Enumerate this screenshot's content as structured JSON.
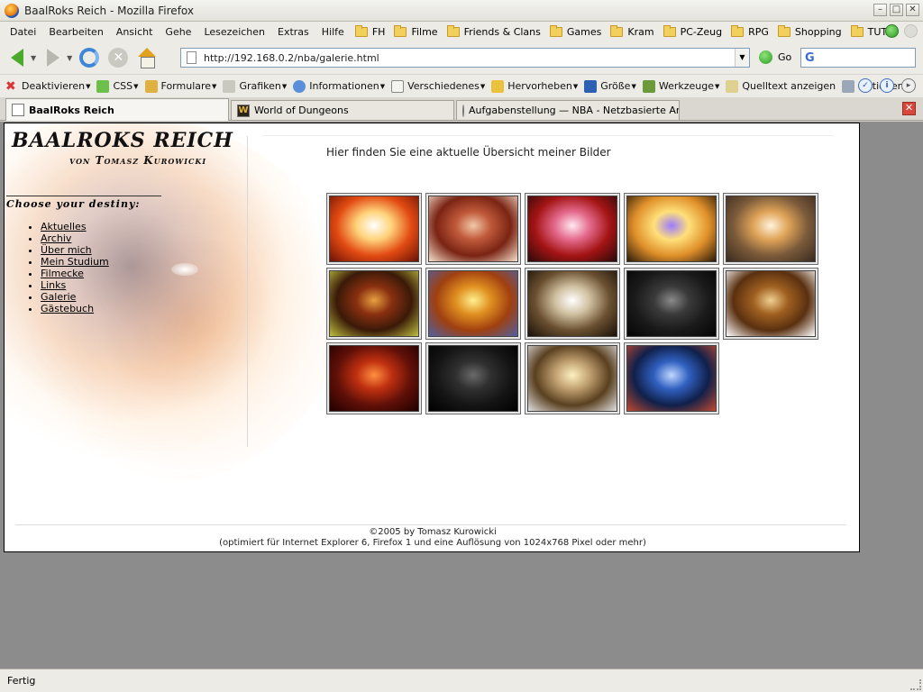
{
  "window": {
    "title": "BaalRoks Reich - Mozilla Firefox"
  },
  "menubar": {
    "items": [
      "Datei",
      "Bearbeiten",
      "Ansicht",
      "Gehe",
      "Lesezeichen",
      "Extras",
      "Hilfe"
    ],
    "bookmarks": [
      "FH",
      "Filme",
      "Friends & Clans",
      "Games",
      "Kram",
      "PC-Zeug",
      "RPG",
      "Shopping",
      "TUTs"
    ]
  },
  "navbar": {
    "url": "http://192.168.0.2/nba/galerie.html",
    "go_label": "Go",
    "search_value": ""
  },
  "devbar": {
    "items": [
      "Deaktivieren",
      "CSS",
      "Formulare",
      "Grafiken",
      "Informationen",
      "Verschiedenes",
      "Hervorheben",
      "Größe",
      "Werkzeuge",
      "Quelltext anzeigen",
      "Optionen"
    ]
  },
  "tabs": [
    {
      "label": "BaalRoks Reich",
      "active": true
    },
    {
      "label": "World of Dungeons",
      "active": false
    },
    {
      "label": "Aufgabenstellung — NBA - Netzbasierte An...",
      "active": false
    }
  ],
  "page": {
    "logo_title": "BaalRoks Reich",
    "logo_sub": "von Tomasz Kurowicki",
    "nav_heading": "Choose your destiny:",
    "nav": [
      "Aktuelles",
      "Archiv",
      "Über mich",
      "Mein Studium",
      "Filmecke",
      "Links",
      "Galerie",
      "Gästebuch"
    ],
    "intro": "Hier finden Sie eine aktuelle Übersicht meiner Bilder",
    "gallery_colors": [
      [
        "#ffffff",
        "#ffd37a",
        "#e24a12",
        "#6a1305"
      ],
      [
        "#f0c9a8",
        "#c0593a",
        "#7a2414",
        "#f6e0cc"
      ],
      [
        "#ffe9f2",
        "#e46a8c",
        "#a41414",
        "#2a0a0a"
      ],
      [
        "#9a7cff",
        "#ffe07a",
        "#e0902a",
        "#2a1a0a"
      ],
      [
        "#fff3dc",
        "#e0a458",
        "#7a5a3a",
        "#3a2a20"
      ],
      [
        "#e8a040",
        "#8a3010",
        "#3a1a08",
        "#c0c040"
      ],
      [
        "#fff090",
        "#e09020",
        "#a04010",
        "#5060a0"
      ],
      [
        "#ffffff",
        "#d0c0a0",
        "#6a5030",
        "#1a1008"
      ],
      [
        "#8a8a8a",
        "#3a3a3a",
        "#1a1a1a",
        "#050505"
      ],
      [
        "#f0d090",
        "#a06020",
        "#5a3010",
        "#ffffff"
      ],
      [
        "#ff9040",
        "#c03010",
        "#601008",
        "#200000"
      ],
      [
        "#6a6a6a",
        "#303030",
        "#151515",
        "#000000"
      ],
      [
        "#fff0c0",
        "#c0a070",
        "#5a4020",
        "#e0e0e0"
      ],
      [
        "#c0d8ff",
        "#3060c0",
        "#10204a",
        "#c04a30"
      ]
    ],
    "footer_line1": "©2005 by Tomasz Kurowicki",
    "footer_line2": "(optimiert für Internet Explorer 6, Firefox 1 und eine Auflösung von 1024x768 Pixel oder mehr)"
  },
  "status": {
    "text": "Fertig"
  }
}
